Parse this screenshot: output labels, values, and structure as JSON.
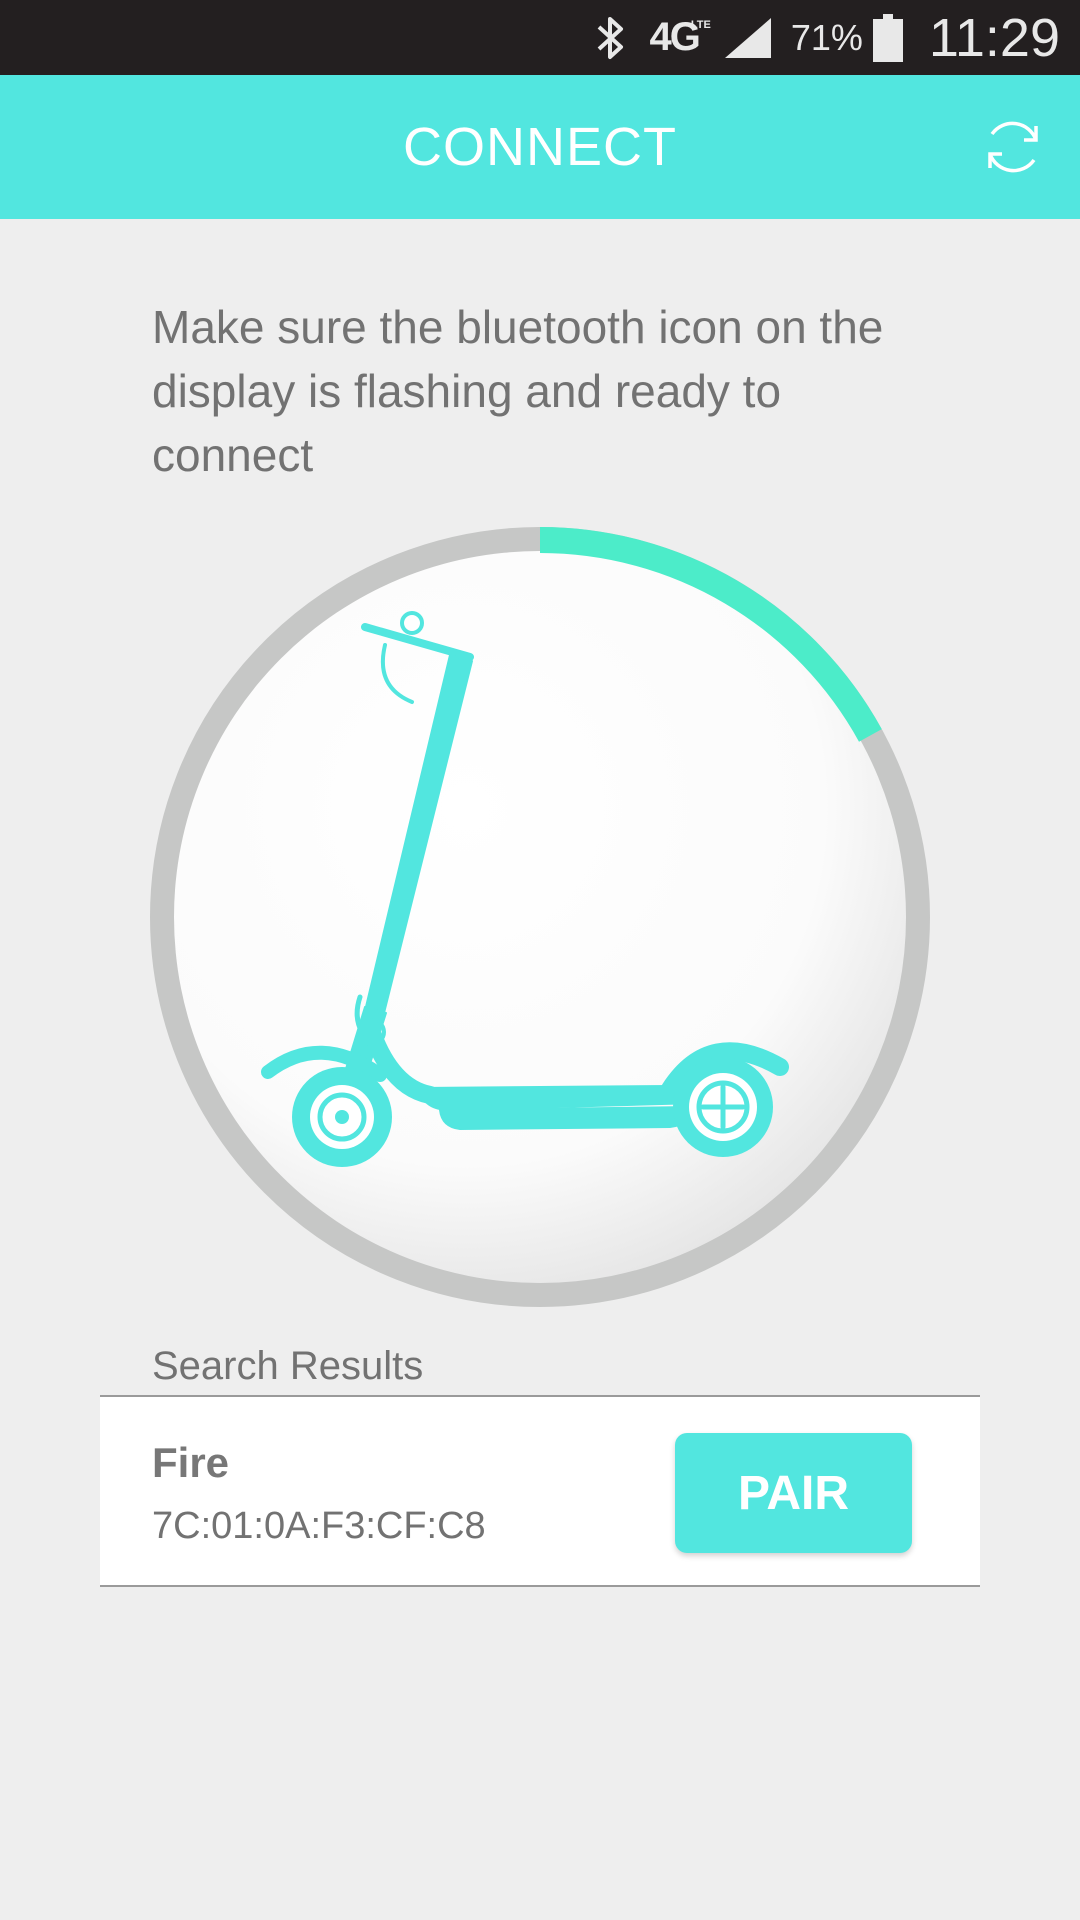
{
  "status_bar": {
    "bluetooth_icon": "bluetooth-icon",
    "network": "4G",
    "network_sub": "LTE",
    "signal_icon": "signal-icon",
    "battery_percent": "71%",
    "battery_icon": "battery-icon",
    "time": "11:29"
  },
  "header": {
    "title": "CONNECT",
    "refresh_icon": "refresh-icon"
  },
  "instruction": "Make sure the bluetooth icon on the display is flashing and ready to connect",
  "scan": {
    "progress": 0.17,
    "accent": "#4cecc9",
    "track": "#c6c7c6",
    "illustration": "scooter-illustration"
  },
  "results": {
    "label": "Search Results",
    "items": [
      {
        "name": "Fire",
        "mac": "7C:01:0A:F3:CF:C8",
        "action": "PAIR"
      }
    ]
  },
  "colors": {
    "brand": "#52e6df",
    "status_bar": "#231f20",
    "background": "#eeeeee",
    "text": "#727272"
  }
}
